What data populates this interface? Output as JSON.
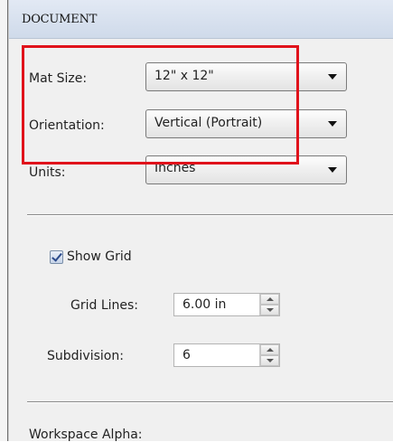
{
  "panel": {
    "title": "DOCUMENT"
  },
  "document": {
    "mat_size": {
      "label": "Mat Size:",
      "value": "12\" x 12\""
    },
    "orientation": {
      "label": "Orientation:",
      "value": "Vertical (Portrait)"
    },
    "units": {
      "label": "Units:",
      "value": "Inches"
    }
  },
  "grid": {
    "show_grid": {
      "label": "Show Grid",
      "checked": true
    },
    "grid_lines": {
      "label": "Grid Lines:",
      "value": "6.00 in"
    },
    "subdivision": {
      "label": "Subdivision:",
      "value": "6"
    }
  },
  "workspace": {
    "alpha_label": "Workspace Alpha:"
  },
  "colors": {
    "highlight": "#e0121b",
    "header": "#cfdaea"
  },
  "icons": [
    "dropdown-arrow-icon",
    "checkmark-icon",
    "spin-up-icon",
    "spin-down-icon"
  ]
}
